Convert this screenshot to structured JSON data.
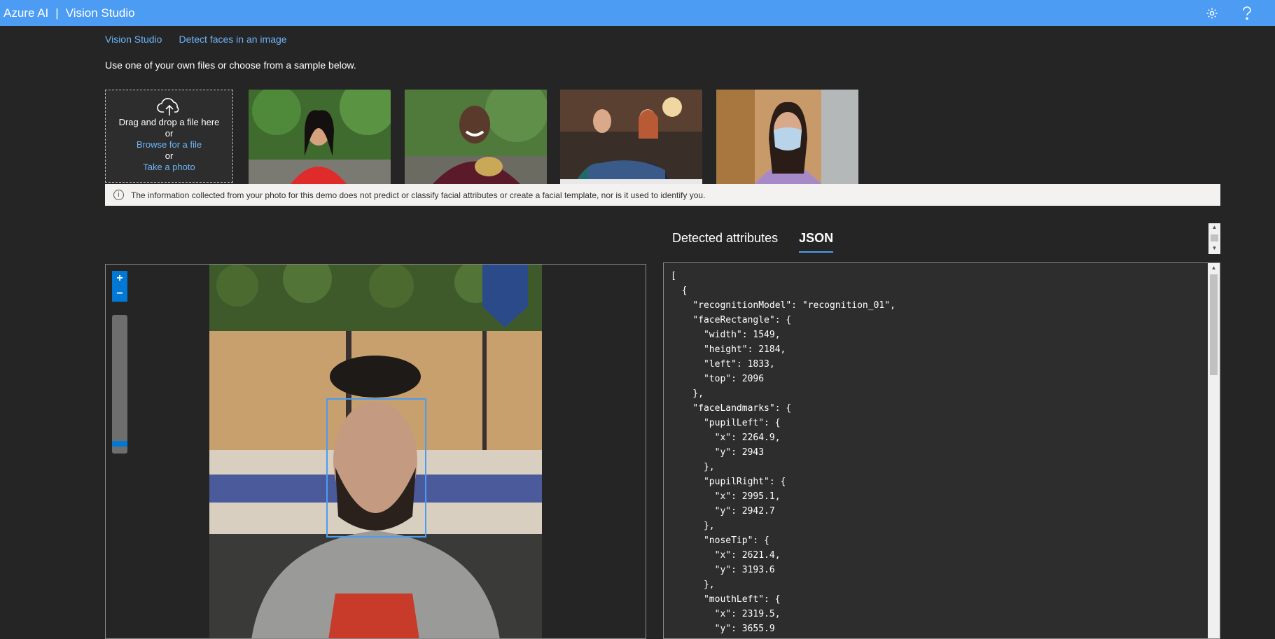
{
  "app": {
    "brand": "Azure AI",
    "separator": "|",
    "product": "Vision Studio"
  },
  "header_icons": [
    "gear-icon",
    "help-icon"
  ],
  "breadcrumb": {
    "home": "Vision Studio",
    "current": "Detect faces in an image"
  },
  "instructions": "Use one of your own files or choose from a sample below.",
  "upload": {
    "drag_text": "Drag and drop a file here",
    "or1": "or",
    "browse_label": "Browse for a file",
    "or2": "or",
    "photo_label": "Take a photo"
  },
  "notice": "The information collected from your photo for this demo does not predict or classify facial attributes or create a facial template, nor is it used to identify you.",
  "tabs": [
    {
      "label": "Detected attributes",
      "active": false
    },
    {
      "label": "JSON",
      "active": true
    }
  ],
  "zoom": {
    "in_label": "+",
    "out_label": "−"
  },
  "json_text": "[\n  {\n    \"recognitionModel\": \"recognition_01\",\n    \"faceRectangle\": {\n      \"width\": 1549,\n      \"height\": 2184,\n      \"left\": 1833,\n      \"top\": 2096\n    },\n    \"faceLandmarks\": {\n      \"pupilLeft\": {\n        \"x\": 2264.9,\n        \"y\": 2943\n      },\n      \"pupilRight\": {\n        \"x\": 2995.1,\n        \"y\": 2942.7\n      },\n      \"noseTip\": {\n        \"x\": 2621.4,\n        \"y\": 3193.6\n      },\n      \"mouthLeft\": {\n        \"x\": 2319.5,\n        \"y\": 3655.9\n      },",
  "colors": {
    "topbar": "#4b9cf2",
    "link": "#6cb4f6",
    "background": "#252526",
    "accent": "#0078d4"
  }
}
